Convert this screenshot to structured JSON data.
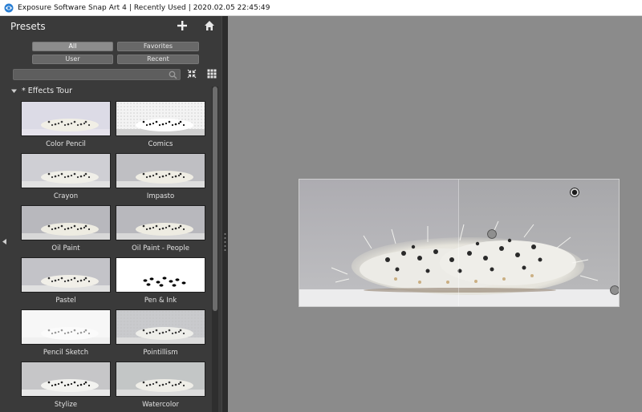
{
  "window": {
    "title": "Exposure Software Snap Art 4 | Recently Used | 2020.02.05 22:45:49"
  },
  "panel": {
    "title": "Presets",
    "add_icon": "plus-icon",
    "home_icon": "home-icon"
  },
  "filters": {
    "all": "All",
    "favorites": "Favorites",
    "user": "User",
    "recent": "Recent",
    "active": "All"
  },
  "search": {
    "value": "",
    "placeholder": ""
  },
  "group": {
    "label": "* Effects Tour"
  },
  "presets": [
    {
      "label": "Color Pencil",
      "style": "pencil"
    },
    {
      "label": "Comics",
      "style": "comics"
    },
    {
      "label": "Crayon",
      "style": "crayon"
    },
    {
      "label": "Impasto",
      "style": "impasto"
    },
    {
      "label": "Oil Paint",
      "style": "oil"
    },
    {
      "label": "Oil Paint - People",
      "style": "oil"
    },
    {
      "label": "Pastel",
      "style": "pastel"
    },
    {
      "label": "Pen & Ink",
      "style": "ink"
    },
    {
      "label": "Pencil Sketch",
      "style": "sketch"
    },
    {
      "label": "Pointillism",
      "style": "point"
    },
    {
      "label": "Stylize",
      "style": "stylize"
    },
    {
      "label": "Watercolor",
      "style": "watercolor"
    }
  ],
  "colors": {
    "panel_bg": "#3a3a3a",
    "canvas_bg": "#8b8b8b",
    "button_active": "#8c8c8c",
    "button": "#686868"
  }
}
